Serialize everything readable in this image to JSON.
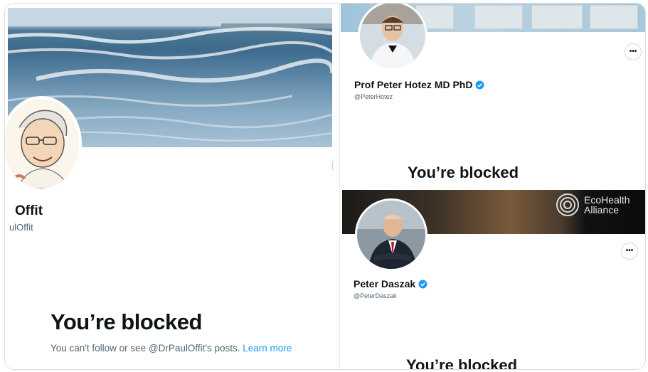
{
  "left_profile": {
    "display_name": "Offit",
    "handle": "ulOffit",
    "blocked_title": "You’re blocked",
    "blocked_message": "You can't follow or see @DrPaulOffit's posts.",
    "learn_more_label": "Learn more"
  },
  "top_right_profile": {
    "display_name": "Prof Peter Hotez MD PhD",
    "handle": "@PeterHotez",
    "blocked_title": "You’re blocked",
    "more_label": "•••"
  },
  "bottom_right_profile": {
    "display_name": "Peter Daszak",
    "handle": "@PeterDaszak",
    "blocked_title": "You’re blocked",
    "more_label": "•••",
    "banner_logo_text": "EcoHealth\nAlliance"
  },
  "colors": {
    "verified_blue": "#1d9bf0",
    "link_blue": "#1d9bf0",
    "text_primary": "#0f1419",
    "text_secondary": "#536471"
  }
}
